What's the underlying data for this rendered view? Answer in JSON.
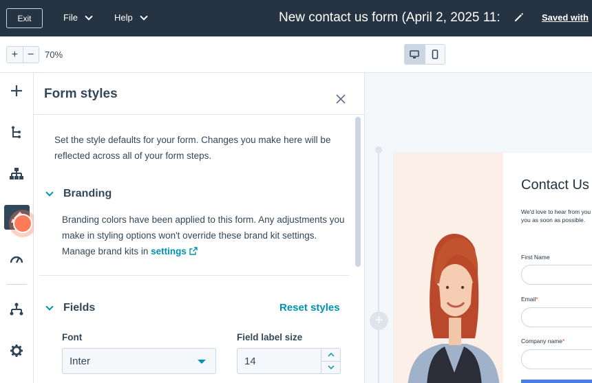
{
  "topbar": {
    "exit_label": "Exit",
    "file_menu": "File",
    "help_menu": "Help",
    "doc_title": "New contact us form (April 2, 2025 11:",
    "saved_label": "Saved with"
  },
  "toolbar": {
    "zoom_in": "+",
    "zoom_out": "−",
    "zoom_level": "70%"
  },
  "panel": {
    "title": "Form styles",
    "intro": "Set the style defaults for your form. Changes you make here will be reflected across all of your form steps.",
    "branding": {
      "heading": "Branding",
      "text": "Branding colors have been applied to this form. Any adjustments you make in styling options won't override these brand kit settings. Manage brand kits in",
      "link": "settings"
    },
    "fields": {
      "heading": "Fields",
      "reset_label": "Reset styles",
      "font_label": "Font",
      "font_value": "Inter",
      "size_label": "Field label size",
      "size_value": "14"
    }
  },
  "preview": {
    "add_step": "+",
    "form_title": "Contact Us",
    "description_line1": "We'd love to hear from you",
    "description_line2": "you as soon as possible.",
    "first_name_label": "First Name",
    "email_label": "Email",
    "company_label": "Company name",
    "required_mark": "*"
  },
  "colors": {
    "topbar": "#253342",
    "accent": "#0091ae",
    "beacon": "#ff7a59"
  }
}
